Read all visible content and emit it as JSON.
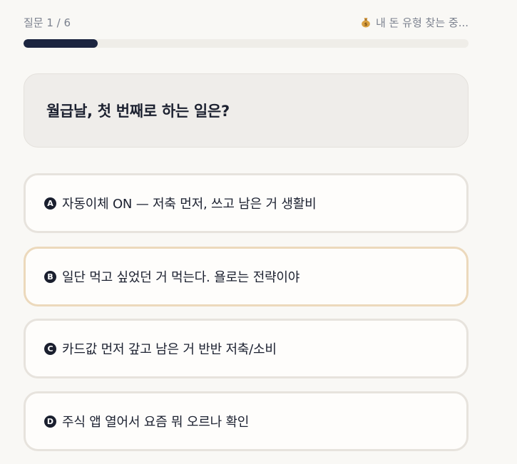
{
  "header": {
    "question_counter": "질문 1 / 6",
    "status_text": "내 돈 유형 찾는 중...",
    "status_icon": "money-bag-icon"
  },
  "progress": {
    "value": 0.167,
    "fill_color": "#1c2540"
  },
  "question": {
    "text": "월급날, 첫 번째로 하는 일은?"
  },
  "options": [
    {
      "badge": "A",
      "text": "자동이체 ON — 저축 먼저, 쓰고 남은 거 생활비"
    },
    {
      "badge": "B",
      "text": "일단 먹고 싶었던 거 먹는다. 욜로는 전략이야"
    },
    {
      "badge": "C",
      "text": "카드값 먼저 갚고 남은 거 반반 저축/소비"
    },
    {
      "badge": "D",
      "text": "주식 앱 열어서 요즘 뭐 오르나 확인"
    }
  ]
}
